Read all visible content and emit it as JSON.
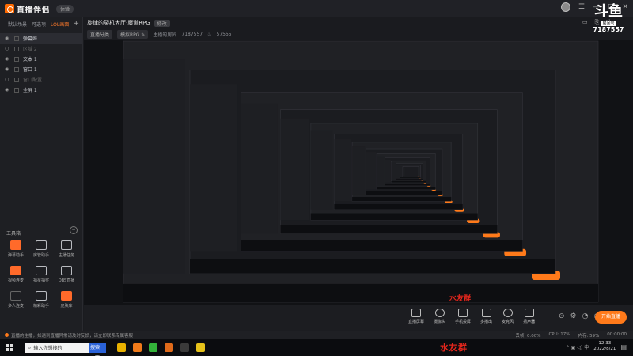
{
  "app": {
    "name": "直播伴侣",
    "version_badge": "体验",
    "window_controls": [
      "☰",
      "—",
      "□",
      "✕"
    ]
  },
  "scene_tabs": [
    "默认场景",
    "可选项",
    "LOL画面"
  ],
  "scene_add": "+",
  "sources": [
    {
      "label": "弹幕姬",
      "visible": true
    },
    {
      "label": "区域 2",
      "visible": false
    },
    {
      "label": "文本 1",
      "visible": true
    },
    {
      "label": "窗口 1",
      "visible": true
    },
    {
      "label": "窗口配置",
      "visible": false
    },
    {
      "label": "全屏 1",
      "visible": true
    }
  ],
  "tools": {
    "heading": "工具箱",
    "collapse": "−",
    "items": [
      {
        "label": "弹幕助手",
        "style": "orange"
      },
      {
        "label": "房管助手",
        "style": "normal"
      },
      {
        "label": "主播任务",
        "style": "normal"
      },
      {
        "label": "视频连麦",
        "style": "orange"
      },
      {
        "label": "福星抽奖",
        "style": "normal"
      },
      {
        "label": "OBS直播",
        "style": "normal"
      },
      {
        "label": "多人连麦",
        "style": "gray"
      },
      {
        "label": "精彩助手",
        "style": "normal"
      },
      {
        "label": "皮肤库",
        "style": "orange"
      }
    ]
  },
  "stream": {
    "title": "旋律的契机大厅·魔道RPG",
    "title_tag": "修改",
    "category": "直播分类",
    "game": "模拟RPG ✎",
    "room_label": "主播的房间",
    "room_id": "7187557",
    "followers": "57555"
  },
  "watermark": {
    "logo": "斗鱼",
    "room_text": "房间号",
    "room_number": "7187557",
    "red_text": "水友群"
  },
  "controls": {
    "items": [
      {
        "label": "直播屏幕",
        "shape": "square"
      },
      {
        "label": "摄像头",
        "shape": "round"
      },
      {
        "label": "手机投屏",
        "shape": "square"
      },
      {
        "label": "多播出",
        "shape": "square"
      },
      {
        "label": "麦克风",
        "shape": "round"
      },
      {
        "label": "扬声器",
        "shape": "square"
      }
    ],
    "extras": [
      "⊙",
      "⚙",
      "◔",
      "◷"
    ],
    "start_label": "开始直播"
  },
  "statusbar": {
    "notice": "直播的主播，如遇到直播异常请及时反馈，请立即联系专属客服",
    "stats": [
      "丢帧: 0.00%",
      "CPU: 17%",
      "内存: 59%",
      "00:00:00"
    ]
  },
  "taskbar": {
    "search_placeholder": "输入你想搜的",
    "search_button": "搜索一下",
    "apps": [
      {
        "name": "chrome",
        "color": "#e8b100"
      },
      {
        "name": "app-orange",
        "color": "#f07a1a"
      },
      {
        "name": "wechat",
        "color": "#33b33a"
      },
      {
        "name": "app-orange2",
        "color": "#e06a1a"
      },
      {
        "name": "app-dark",
        "color": "#3a3a3a"
      },
      {
        "name": "app-yellow",
        "color": "#e6c21a"
      }
    ],
    "clock_time": "12:33",
    "clock_date": "2022/8/21"
  },
  "colors": {
    "accent": "#ff7a1a",
    "bg": "#1a1b1f",
    "watermark_red": "#e3261c"
  }
}
